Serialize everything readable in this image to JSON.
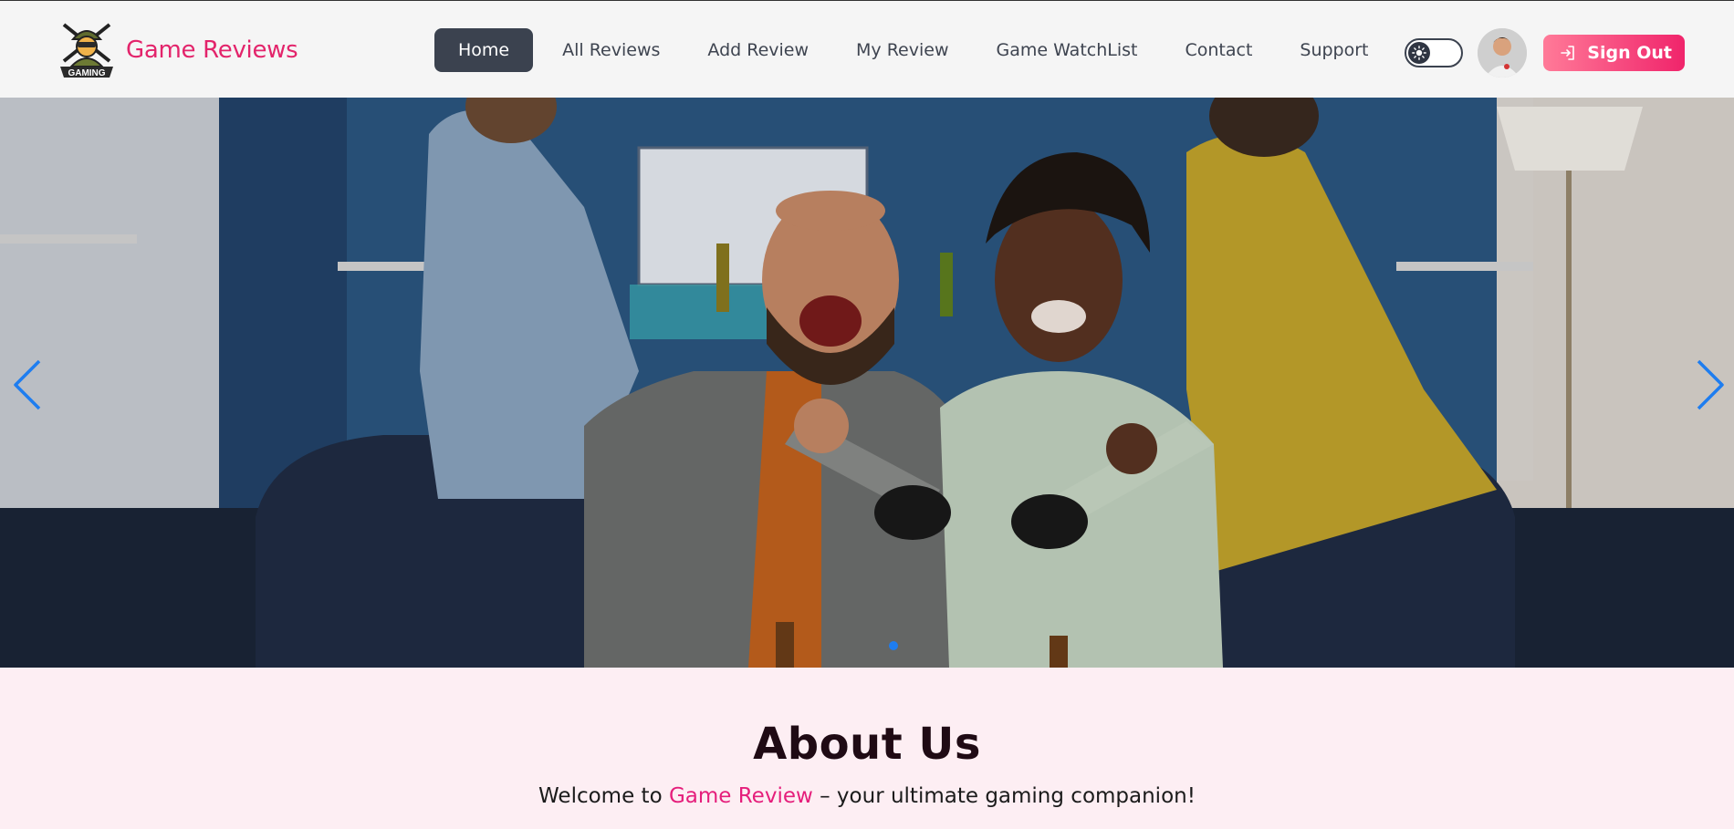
{
  "brand": {
    "title": "Game Reviews",
    "logo_text": "GAMING",
    "logo_icon": "gaming-mascot-logo"
  },
  "nav": {
    "items": [
      {
        "label": "Home",
        "active": true
      },
      {
        "label": "All Reviews",
        "active": false
      },
      {
        "label": "Add Review",
        "active": false
      },
      {
        "label": "My Review",
        "active": false
      },
      {
        "label": "Game WatchList",
        "active": false
      },
      {
        "label": "Contact",
        "active": false
      },
      {
        "label": "Support",
        "active": false
      }
    ]
  },
  "header_actions": {
    "theme_toggle_icon": "sun-icon",
    "signout_label": "Sign Out",
    "signout_icon": "sign-in-arrow-icon"
  },
  "hero": {
    "slide_description_icon": "friends-playing-video-games-photo",
    "prev_icon": "chevron-left-icon",
    "next_icon": "chevron-right-icon",
    "active_slide": 1,
    "slide_count": 1
  },
  "about": {
    "heading": "About Us",
    "intro_prefix": "Welcome to ",
    "intro_highlight": "Game Review",
    "intro_suffix": " – your ultimate gaming companion!"
  },
  "colors": {
    "brand_pink": "#e3246b",
    "nav_active_bg": "#3b424f",
    "signout_gradient_start": "#ff7a98",
    "signout_gradient_end": "#f0246b",
    "carousel_accent": "#1e7df0",
    "about_bg": "#fdeef3"
  }
}
